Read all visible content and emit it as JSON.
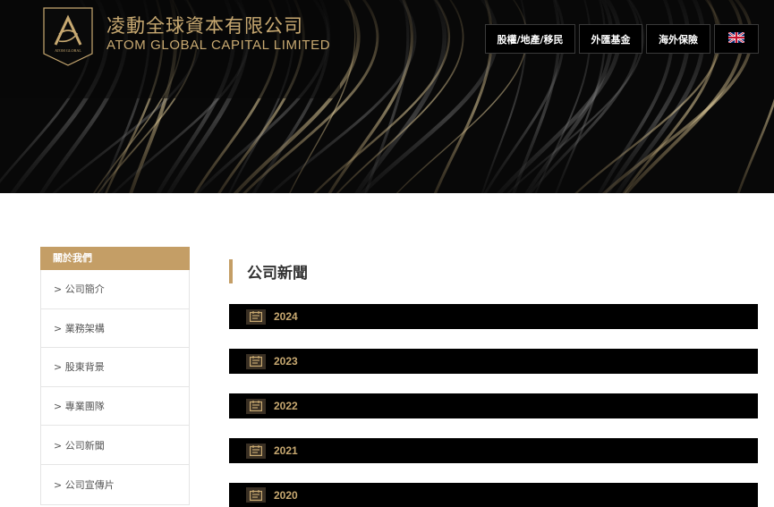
{
  "brand": {
    "name_cn": "凌動全球資本有限公司",
    "name_en": "ATOM GLOBAL CAPITAL LIMITED",
    "logo_caption": "ATOM GLOBAL"
  },
  "nav": {
    "items": [
      {
        "label": "股權/地產/移民"
      },
      {
        "label": "外匯基金"
      },
      {
        "label": "海外保險"
      }
    ],
    "language_icon": "uk-flag-icon"
  },
  "sidebar": {
    "header": "關於我們",
    "items": [
      {
        "label": "> 公司簡介"
      },
      {
        "label": "> 業務架構"
      },
      {
        "label": "> 股東背景"
      },
      {
        "label": "> 專業團隊"
      },
      {
        "label": "> 公司新聞"
      },
      {
        "label": "> 公司宣傳片"
      }
    ]
  },
  "content": {
    "title": "公司新聞",
    "years": [
      {
        "label": "2024"
      },
      {
        "label": "2023"
      },
      {
        "label": "2022"
      },
      {
        "label": "2021"
      },
      {
        "label": "2020"
      }
    ],
    "year_icon": "calendar-icon"
  },
  "colors": {
    "gold": "#c8a971",
    "accent": "#c49e66",
    "banner_bg": "#080808",
    "bar_bg": "#000000"
  }
}
